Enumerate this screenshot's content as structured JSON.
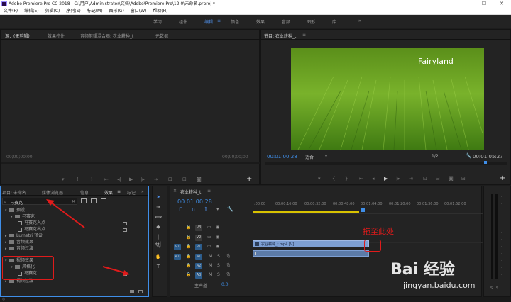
{
  "titlebar": {
    "title": "Adobe Premiere Pro CC 2018 - C:\\用户\\Administrator\\文档\\Adobe\\Premiere Pro\\12.0\\未命名.prproj *"
  },
  "menu": [
    "文件(F)",
    "编辑(E)",
    "剪辑(C)",
    "序列(S)",
    "标记(M)",
    "图形(G)",
    "窗口(W)",
    "帮助(H)"
  ],
  "workspaces": [
    {
      "label": "学习"
    },
    {
      "label": "组件"
    },
    {
      "label": "编辑",
      "active": true
    },
    {
      "label": "颜色"
    },
    {
      "label": "效果"
    },
    {
      "label": "音频"
    },
    {
      "label": "图形"
    },
    {
      "label": "库"
    }
  ],
  "workspace_more": "»",
  "source_panel": {
    "tabs": [
      {
        "label": "源：(无剪辑)",
        "active": true
      },
      {
        "label": "效果控件"
      },
      {
        "label": "音频剪辑混合器: 农业耕种_t"
      },
      {
        "label": "元数据"
      }
    ],
    "timecode_left": "00;00;00;00",
    "timecode_right": "00;00;00;00"
  },
  "program_panel": {
    "title": "节目: 农业耕种_t",
    "video_caption": "Fairyland",
    "timecode_current": "00:01:00:28",
    "fit": "适合",
    "resolution": "1/2",
    "duration": "00:01:05:27"
  },
  "project_panel": {
    "tabs": [
      {
        "label": "项目: 未命名"
      },
      {
        "label": "媒体浏览器"
      },
      {
        "label": "信息"
      },
      {
        "label": "效果",
        "active": true
      },
      {
        "label": "标记"
      }
    ],
    "search_value": "马赛克",
    "tree": [
      {
        "label": "预设",
        "indent": 0
      },
      {
        "label": "马赛克",
        "indent": 1
      },
      {
        "label": "马赛克入点",
        "indent": 2
      },
      {
        "label": "马赛克出点",
        "indent": 2
      },
      {
        "label": "Lumetri 预设",
        "indent": 0
      },
      {
        "label": "音频效果",
        "indent": 0
      },
      {
        "label": "音频过渡",
        "indent": 0
      },
      {
        "label": "视频效果",
        "indent": 0
      },
      {
        "label": "风格化",
        "indent": 1
      },
      {
        "label": "马赛克",
        "indent": 2
      },
      {
        "label": "视频过渡",
        "indent": 0
      }
    ]
  },
  "timeline": {
    "sequence_tab": "农业耕种_t",
    "timecode": "00:01:00:28",
    "ruler": [
      ":00:00",
      "00:00:16:00",
      "00:00:32:00",
      "00:00:48:00",
      "00:01:04:00",
      "00:01:20:00",
      "00:01:36:00",
      "00:01:52:00"
    ],
    "tracks": [
      {
        "label": "V3",
        "kind": "video"
      },
      {
        "label": "V2",
        "kind": "video"
      },
      {
        "label": "V1",
        "kind": "video",
        "target": true
      },
      {
        "label": "A1",
        "kind": "audio"
      },
      {
        "label": "A2",
        "kind": "audio"
      },
      {
        "label": "A3",
        "kind": "audio"
      }
    ],
    "master_label": "主声道",
    "master_value": "0.0",
    "clip_label": "农业耕种_t.mp4 [V]",
    "drop_annotation": "拖至此处"
  },
  "watermark": {
    "line1": "Bai 经验",
    "line2": "jingyan.baidu.com"
  },
  "colors": {
    "accent": "#3f8ee8",
    "annotation": "#e01b1b",
    "clip": "#7d9fd3"
  }
}
